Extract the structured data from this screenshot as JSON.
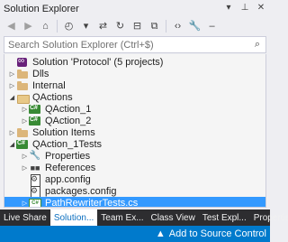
{
  "window": {
    "title": "Solution Explorer"
  },
  "title_icons": [
    "dropdown-icon",
    "pin-icon",
    "close-icon"
  ],
  "toolbar": [
    {
      "name": "back-icon",
      "glyph": "◀",
      "dim": true
    },
    {
      "name": "forward-icon",
      "glyph": "▶",
      "dim": true
    },
    {
      "name": "home-icon",
      "glyph": "⌂"
    },
    {
      "sep": true
    },
    {
      "name": "pending-changes-filter-icon",
      "glyph": "◴"
    },
    {
      "name": "dropdown-icon",
      "glyph": "▾"
    },
    {
      "name": "sync-icon",
      "glyph": "⇄"
    },
    {
      "name": "refresh-icon",
      "glyph": "↻"
    },
    {
      "name": "collapse-all-icon",
      "glyph": "⊟"
    },
    {
      "name": "show-all-files-icon",
      "glyph": "⧉"
    },
    {
      "sep": true
    },
    {
      "name": "view-code-icon",
      "glyph": "‹›"
    },
    {
      "name": "properties-icon",
      "glyph": "🔧"
    },
    {
      "name": "minus-icon",
      "glyph": "–"
    }
  ],
  "search": {
    "placeholder": "Search Solution Explorer (Ctrl+$)"
  },
  "tree": [
    {
      "label": "Solution 'Protocol' (5 projects)",
      "level": 0,
      "arrow": "",
      "icon": "solution"
    },
    {
      "label": "Dlls",
      "level": 0,
      "arrow": "▷",
      "icon": "folder"
    },
    {
      "label": "Internal",
      "level": 0,
      "arrow": "▷",
      "icon": "folder"
    },
    {
      "label": "QActions",
      "level": 0,
      "arrow": "◢",
      "icon": "folder-open"
    },
    {
      "label": "QAction_1",
      "level": 1,
      "arrow": "▷",
      "icon": "csproj"
    },
    {
      "label": "QAction_2",
      "level": 1,
      "arrow": "▷",
      "icon": "csproj"
    },
    {
      "label": "Solution Items",
      "level": 0,
      "arrow": "▷",
      "icon": "folder"
    },
    {
      "label": "QAction_1Tests",
      "level": 0,
      "arrow": "◢",
      "icon": "csproj"
    },
    {
      "label": "Properties",
      "level": 1,
      "arrow": "▷",
      "icon": "wrench"
    },
    {
      "label": "References",
      "level": 1,
      "arrow": "▷",
      "icon": "refs"
    },
    {
      "label": "app.config",
      "level": 1,
      "arrow": "",
      "icon": "config"
    },
    {
      "label": "packages.config",
      "level": 1,
      "arrow": "",
      "icon": "config"
    },
    {
      "label": "PathRewriterTests.cs",
      "level": 1,
      "arrow": "▷",
      "icon": "cs",
      "selected": true
    }
  ],
  "tabs": [
    {
      "label": "Live Share",
      "active": false
    },
    {
      "label": "Solution...",
      "active": true
    },
    {
      "label": "Team Ex...",
      "active": false
    },
    {
      "label": "Class View",
      "active": false
    },
    {
      "label": "Test Expl...",
      "active": false
    },
    {
      "label": "Properties",
      "active": false
    }
  ],
  "status": {
    "text": "Add to Source Control",
    "arrow": "▲"
  }
}
